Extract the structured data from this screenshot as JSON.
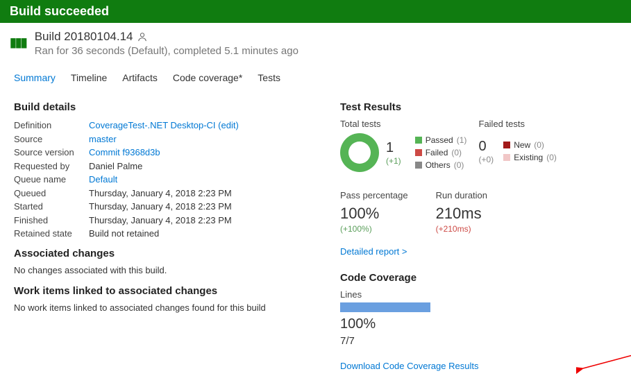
{
  "banner": {
    "status": "Build succeeded"
  },
  "header": {
    "title": "Build 20180104.14",
    "subtitle": "Ran for 36 seconds (Default), completed 5.1 minutes ago"
  },
  "tabs": {
    "summary": "Summary",
    "timeline": "Timeline",
    "artifacts": "Artifacts",
    "coverage": "Code coverage*",
    "tests": "Tests"
  },
  "details": {
    "heading": "Build details",
    "labels": {
      "definition": "Definition",
      "source": "Source",
      "sourceVersion": "Source version",
      "requestedBy": "Requested by",
      "queueName": "Queue name",
      "queued": "Queued",
      "started": "Started",
      "finished": "Finished",
      "retained": "Retained state"
    },
    "values": {
      "definition": "CoverageTest-.NET Desktop-CI (edit)",
      "source": "master",
      "sourceVersion": "Commit f9368d3b",
      "requestedBy": "Daniel Palme",
      "queueName": "Default",
      "queued": "Thursday, January 4, 2018 2:23 PM",
      "started": "Thursday, January 4, 2018 2:23 PM",
      "finished": "Thursday, January 4, 2018 2:23 PM",
      "retained": "Build not retained"
    }
  },
  "associated": {
    "heading": "Associated changes",
    "text": "No changes associated with this build."
  },
  "workitems": {
    "heading": "Work items linked to associated changes",
    "text": "No work items linked to associated changes found for this build"
  },
  "testResults": {
    "heading": "Test Results",
    "totalLabel": "Total tests",
    "totalValue": "1",
    "totalDelta": "(+1)",
    "legend": {
      "passedLabel": "Passed",
      "passedCount": "(1)",
      "failedLabel": "Failed",
      "failedCount": "(0)",
      "othersLabel": "Others",
      "othersCount": "(0)"
    },
    "failedLabel": "Failed tests",
    "failedValue": "0",
    "failedDelta": "(+0)",
    "fLegend": {
      "newLabel": "New",
      "newCount": "(0)",
      "existingLabel": "Existing",
      "existingCount": "(0)"
    },
    "passPctLabel": "Pass percentage",
    "passPctValue": "100%",
    "passPctDelta": "(+100%)",
    "durationLabel": "Run duration",
    "durationValue": "210ms",
    "durationDelta": "(+210ms)",
    "detailedLink": "Detailed report >"
  },
  "coverage": {
    "heading": "Code Coverage",
    "linesLabel": "Lines",
    "pct": "100%",
    "frac": "7/7",
    "download": "Download Code Coverage Results"
  },
  "chart_data": {
    "type": "pie",
    "title": "Total tests",
    "categories": [
      "Passed",
      "Failed",
      "Others"
    ],
    "values": [
      1,
      0,
      0
    ],
    "series_colors": [
      "#55b455",
      "#cd4a45",
      "#888"
    ]
  }
}
